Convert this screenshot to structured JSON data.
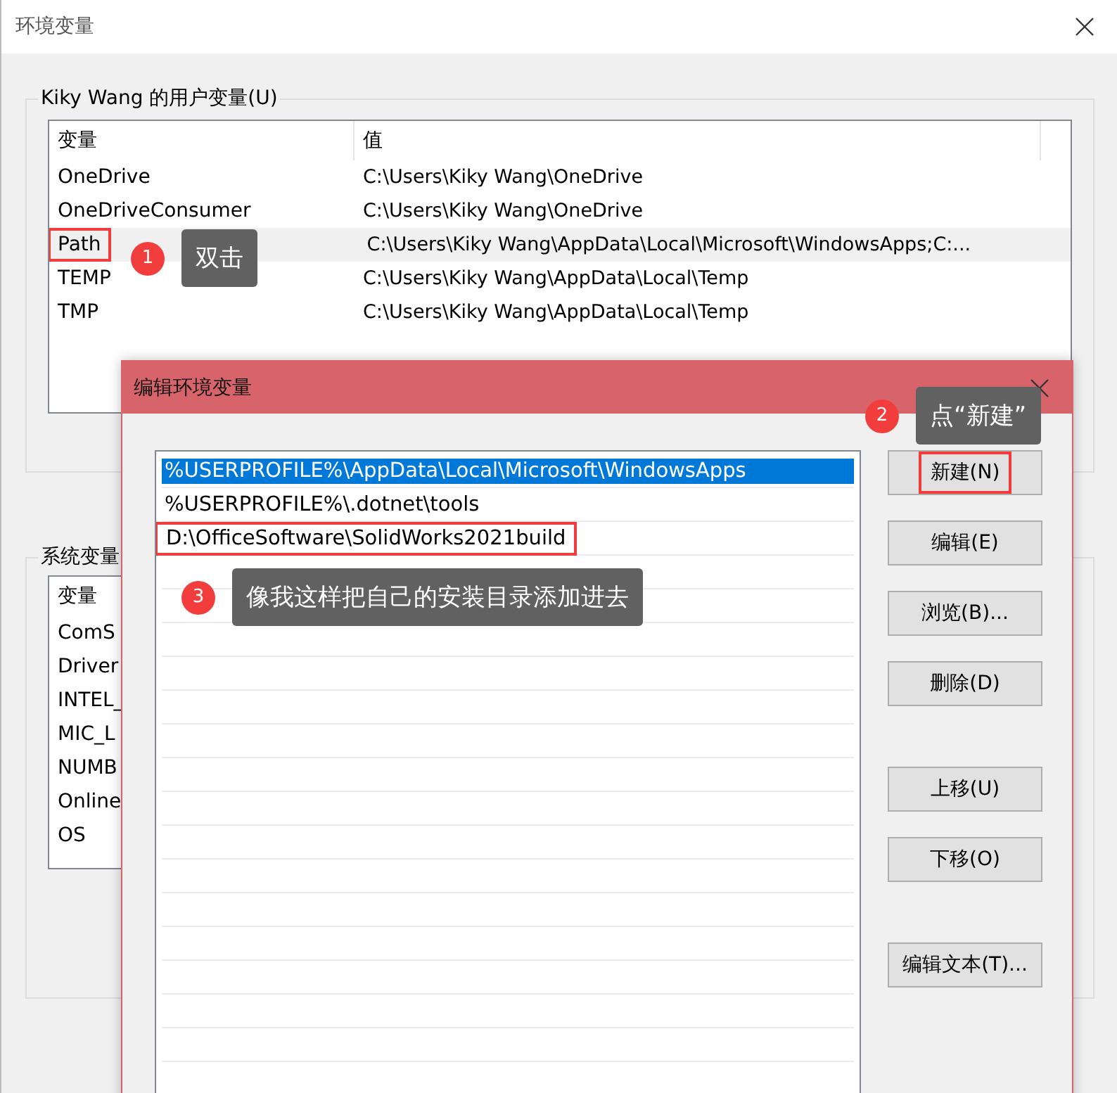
{
  "window": {
    "title": "环境变量"
  },
  "user_vars": {
    "label": "Kiky Wang 的用户变量(U)",
    "columns": [
      "变量",
      "值"
    ],
    "rows": [
      {
        "name": "OneDrive",
        "value": "C:\\Users\\Kiky Wang\\OneDrive",
        "hovered": false,
        "marked": false
      },
      {
        "name": "OneDriveConsumer",
        "value": "C:\\Users\\Kiky Wang\\OneDrive",
        "hovered": false,
        "marked": false
      },
      {
        "name": "Path",
        "value": "C:\\Users\\Kiky Wang\\AppData\\Local\\Microsoft\\WindowsApps;C:...",
        "hovered": true,
        "marked": true
      },
      {
        "name": "TEMP",
        "value": "C:\\Users\\Kiky Wang\\AppData\\Local\\Temp",
        "hovered": false,
        "marked": false
      },
      {
        "name": "TMP",
        "value": "C:\\Users\\Kiky Wang\\AppData\\Local\\Temp",
        "hovered": false,
        "marked": false
      }
    ]
  },
  "system_vars": {
    "label": "系统变量",
    "columns": [
      "变量"
    ],
    "rows": [
      {
        "name": "ComS"
      },
      {
        "name": "Driver"
      },
      {
        "name": "INTEL_"
      },
      {
        "name": "MIC_L"
      },
      {
        "name": "NUMB"
      },
      {
        "name": "Online"
      },
      {
        "name": "OS"
      }
    ]
  },
  "edit_dialog": {
    "title": "编辑环境变量",
    "entries": [
      {
        "text": "%USERPROFILE%\\AppData\\Local\\Microsoft\\WindowsApps",
        "selected": true,
        "marked": false
      },
      {
        "text": "%USERPROFILE%\\.dotnet\\tools",
        "selected": false,
        "marked": false
      },
      {
        "text": "D:\\OfficeSoftware\\SolidWorks2021build",
        "selected": false,
        "marked": true
      }
    ],
    "buttons": [
      {
        "label": "新建(N)",
        "marked": true
      },
      {
        "label": "编辑(E)",
        "marked": false
      },
      {
        "label": "浏览(B)...",
        "marked": false
      },
      {
        "label": "删除(D)",
        "marked": false
      },
      {
        "label": "上移(U)",
        "marked": false
      },
      {
        "label": "下移(O)",
        "marked": false
      },
      {
        "label": "编辑文本(T)...",
        "marked": false
      }
    ]
  },
  "annotations": [
    {
      "number": "1",
      "text": "双击"
    },
    {
      "number": "2",
      "text": "点“新建”"
    },
    {
      "number": "3",
      "text": "像我这样把自己的安装目录添加进去"
    }
  ]
}
